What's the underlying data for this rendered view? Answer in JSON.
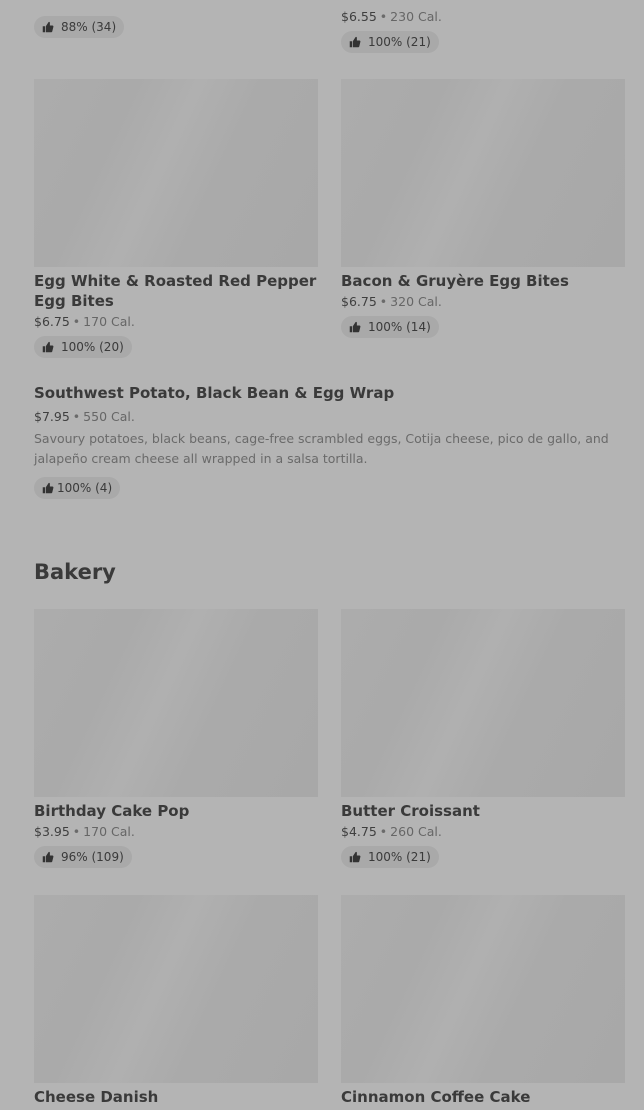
{
  "top_items": [
    {
      "price": "$6.55",
      "calories": "230 Cal.",
      "rating": "100% (21)"
    },
    {
      "price": "",
      "calories": "",
      "rating": "88% (34)"
    }
  ],
  "breakfast_items": [
    {
      "name": "Egg White & Roasted Red Pepper Egg Bites",
      "price": "$6.75",
      "calories": "170 Cal.",
      "rating": "100% (20)"
    },
    {
      "name": "Bacon & Gruyère Egg Bites",
      "price": "$6.75",
      "calories": "320 Cal.",
      "rating": "100% (14)"
    }
  ],
  "wide_item": {
    "name": "Southwest Potato, Black Bean & Egg Wrap",
    "price": "$7.95",
    "calories": "550 Cal.",
    "description": "Savoury potatoes, black beans, cage-free scrambled eggs, Cotija cheese, pico de gallo, and jalapeño cream cheese all wrapped in a salsa tortilla.",
    "rating": "100% (4)"
  },
  "bakery": {
    "title": "Bakery",
    "items": [
      {
        "name": "Birthday Cake Pop",
        "price": "$3.95",
        "calories": "170 Cal.",
        "rating": "96% (109)"
      },
      {
        "name": "Butter Croissant",
        "price": "$4.75",
        "calories": "260 Cal.",
        "rating": "100% (21)"
      },
      {
        "name": "Cheese Danish"
      },
      {
        "name": "Cinnamon Coffee Cake"
      }
    ]
  },
  "icons": {
    "rating": "thumbs-up-icon"
  },
  "colors": {
    "background": "#b4b4b4",
    "thumbnail": "#aaaaaa",
    "pill": "#a9a9a9",
    "text": "#3a3a3a"
  }
}
